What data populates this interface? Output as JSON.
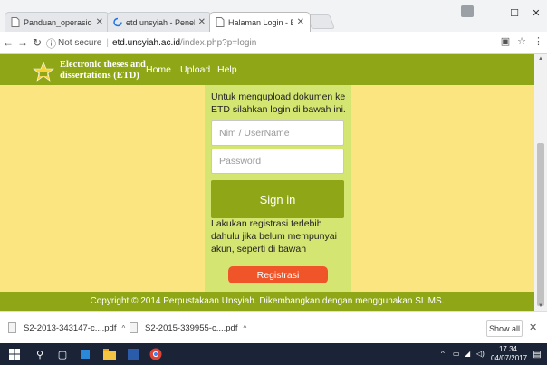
{
  "browser": {
    "tabs": [
      {
        "title": "Panduan_operasional_ET",
        "active": false
      },
      {
        "title": "etd unsyiah - Penelusura",
        "active": false
      },
      {
        "title": "Halaman Login - ETD Sy",
        "active": true
      }
    ],
    "address": {
      "security_label": "Not secure",
      "host": "etd.unsyiah.ac.id",
      "path": "/index.php?p=login"
    },
    "window_controls": {
      "minimize": "–",
      "maximize": "☐",
      "close": "✕"
    }
  },
  "site": {
    "brand_line1": "Electronic theses and",
    "brand_line2": "dissertations (ETD)",
    "nav": [
      "Home",
      "Upload",
      "Help"
    ],
    "accent_color": "#8fa716",
    "background_color": "#fbe580"
  },
  "login": {
    "intro": "Untuk mengupload dokumen ke ETD silahkan login di bawah ini.",
    "username_placeholder": "Nim / UserName",
    "password_placeholder": "Password",
    "signin_label": "Sign in",
    "register_note": "Lakukan registrasi terlebih dahulu jika belum mempunyai akun, seperti di bawah",
    "register_label": "Registrasi"
  },
  "footer": {
    "text": "Copyright © 2014 Perpustakaan Unsyiah. Dikembangkan dengan menggunakan SLiMS."
  },
  "downloads": {
    "items": [
      "S2-2013-343147-c....pdf",
      "S2-2015-339955-c....pdf"
    ],
    "show_all": "Show all"
  },
  "taskbar": {
    "time": "17.34",
    "date": "04/07/2017"
  }
}
